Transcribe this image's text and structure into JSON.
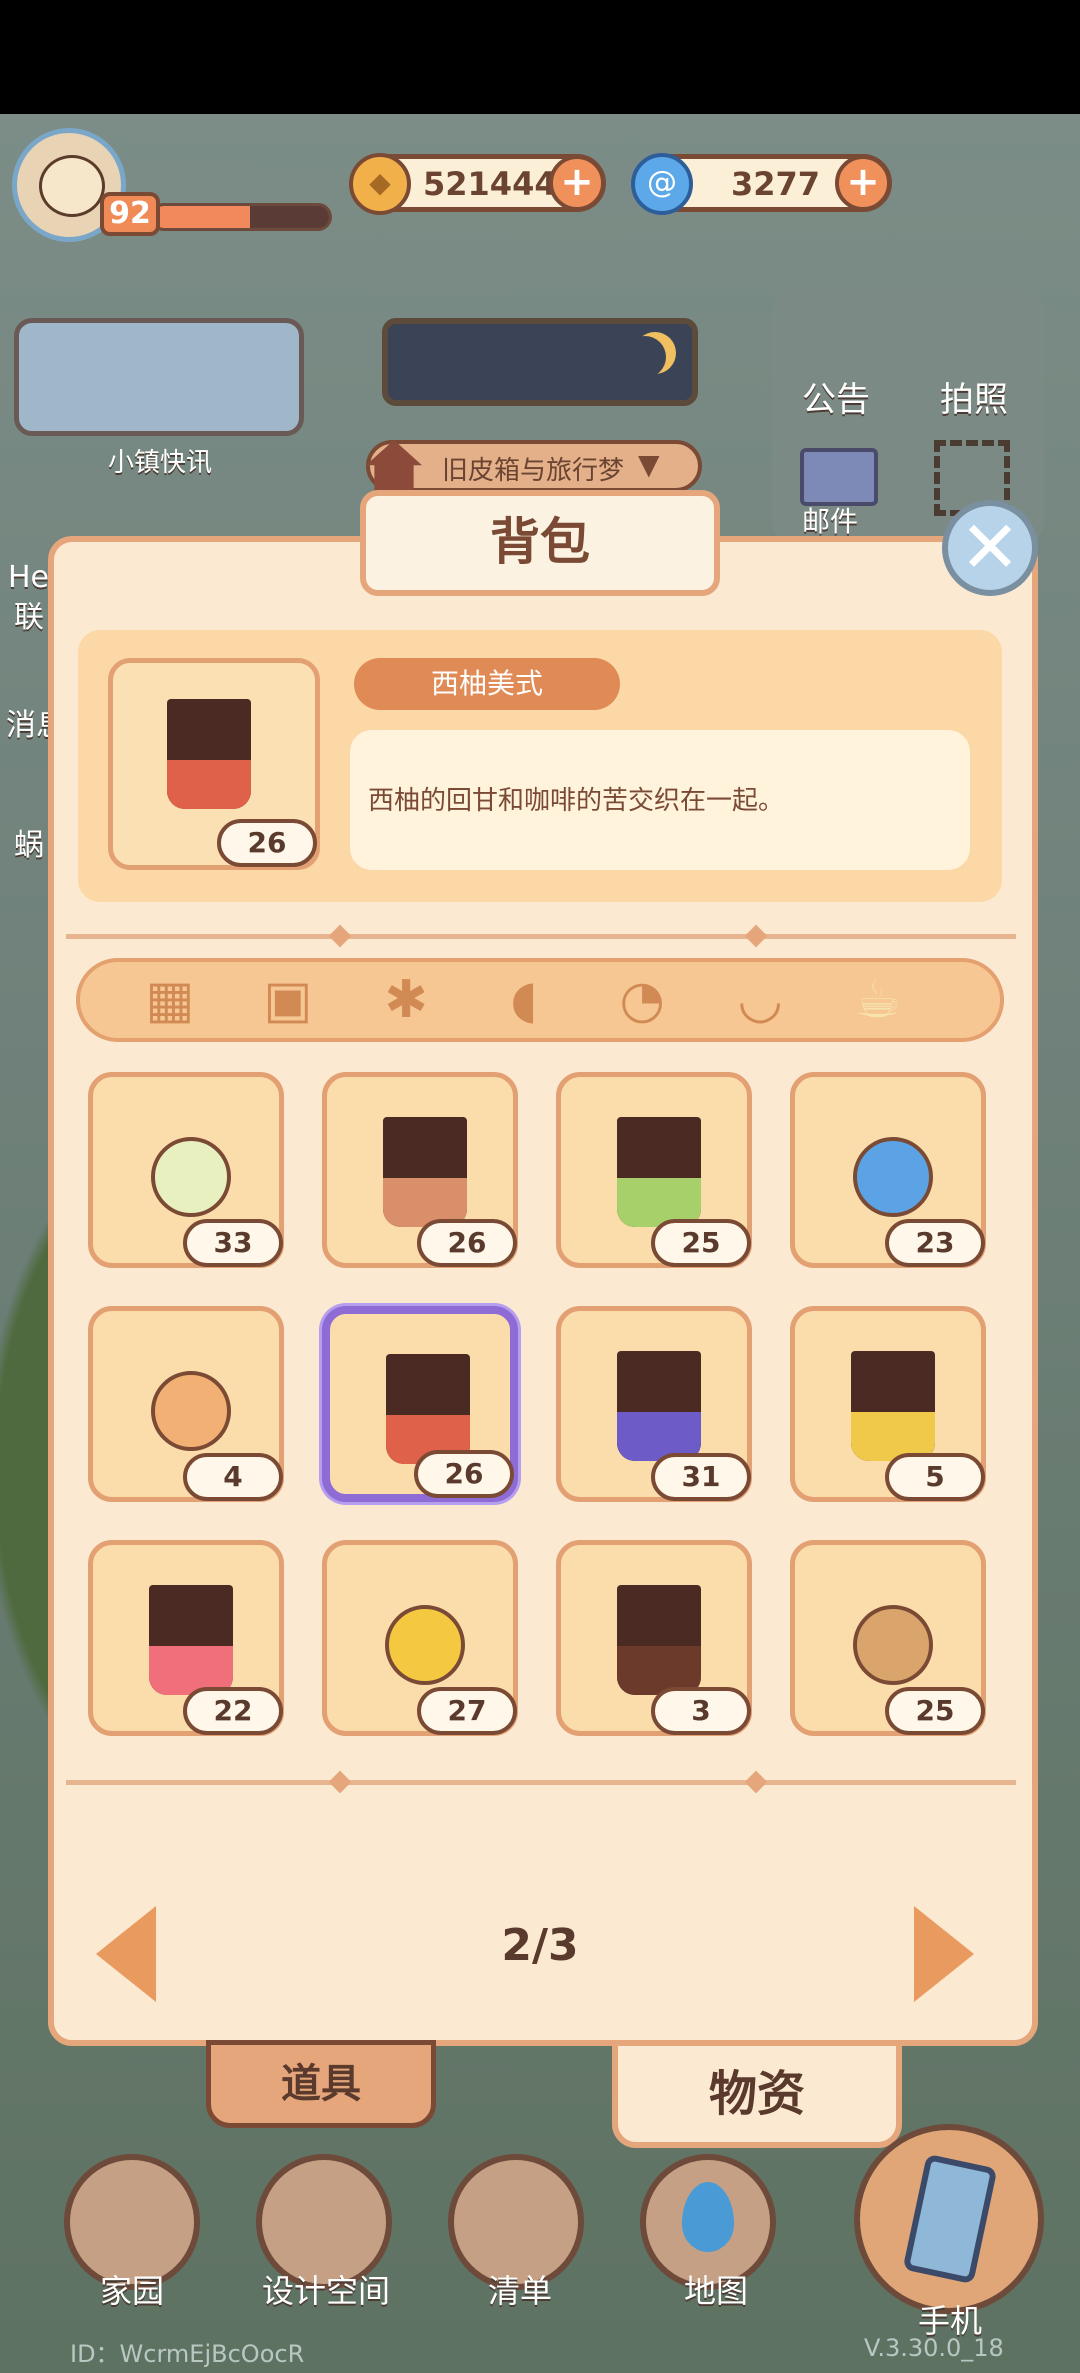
{
  "player": {
    "level": "92",
    "xp_fraction": 0.55
  },
  "currencies": {
    "coins": "521444",
    "gems": "3277"
  },
  "news": {
    "label": "小镇快讯"
  },
  "location": {
    "label": "旧皮箱与旅行梦"
  },
  "right_menu": {
    "announce": "公告",
    "photo": "拍照",
    "mail": "邮件"
  },
  "side_labels": [
    "He",
    "联",
    "消息",
    "蜗"
  ],
  "bag": {
    "title": "背包",
    "selected": {
      "name": "西柚美式",
      "description": "西柚的回甘和咖啡的苦交织在一起。",
      "qty": "26"
    },
    "category_icons": [
      "grid-icon",
      "seed-icon",
      "plant-icon",
      "fish-icon",
      "meat-icon",
      "soup-icon",
      "coffee-icon"
    ],
    "active_category": 6,
    "items": [
      {
        "qty": "33",
        "kind": "ball",
        "color": "#e8f0c0"
      },
      {
        "qty": "26",
        "kind": "cup",
        "color": "#d98f6a"
      },
      {
        "qty": "25",
        "kind": "cup",
        "color": "#a7d06a"
      },
      {
        "qty": "23",
        "kind": "ball",
        "color": "#5ca3e6"
      },
      {
        "qty": "4",
        "kind": "ball",
        "color": "#f2b074"
      },
      {
        "qty": "26",
        "kind": "cup",
        "color": "#e0614a",
        "selected": true
      },
      {
        "qty": "31",
        "kind": "cup",
        "color": "#6d5bc8"
      },
      {
        "qty": "5",
        "kind": "cup",
        "color": "#f0c84a"
      },
      {
        "qty": "22",
        "kind": "cup",
        "color": "#f06f7a"
      },
      {
        "qty": "27",
        "kind": "ball",
        "color": "#f5c842"
      },
      {
        "qty": "3",
        "kind": "cup",
        "color": "#6b3a2a"
      },
      {
        "qty": "25",
        "kind": "ball",
        "color": "#d9a56d"
      }
    ],
    "page": "2/3",
    "tabs": {
      "props": "道具",
      "materials": "物资"
    }
  },
  "bottom_nav": {
    "home": "家园",
    "design": "设计空间",
    "list": "清单",
    "map": "地图",
    "phone": "手机"
  },
  "footer": {
    "id": "ID：WcrmEjBcOocR",
    "version": "V.3.30.0_18"
  }
}
